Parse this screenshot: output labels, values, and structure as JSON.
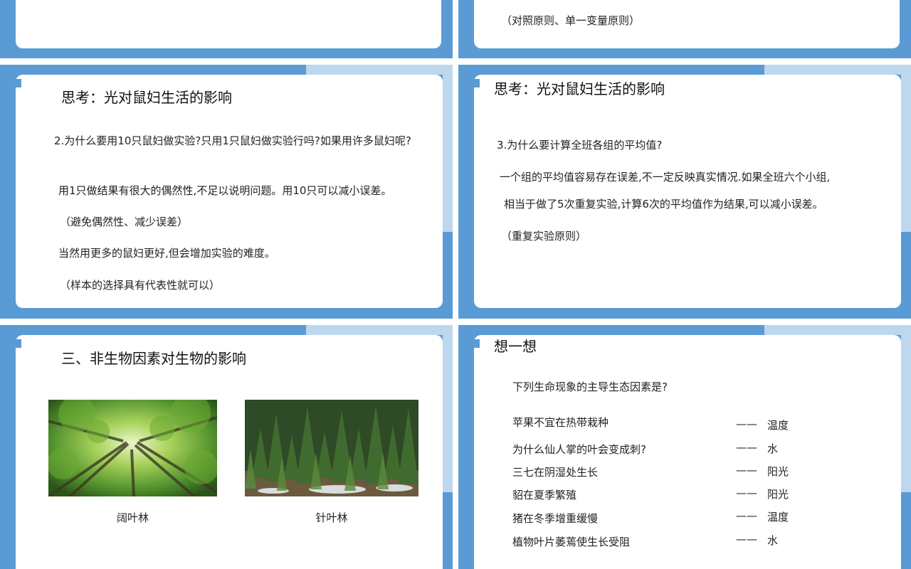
{
  "slide_top_right": {
    "text": "（对照原则、单一变量原则）"
  },
  "slide_mid_left": {
    "title": "思考：光对鼠妇生活的影响",
    "question": "2.为什么要用10只鼠妇做实验?只用1只鼠妇做实验行吗?如果用许多鼠妇呢?",
    "lines": [
      "用1只做结果有很大的偶然性,不足以说明问题。用10只可以减小误差。",
      "（避免偶然性、减少误差）",
      "当然用更多的鼠妇更好,但会增加实验的难度。",
      "（样本的选择具有代表性就可以）"
    ]
  },
  "slide_mid_right": {
    "title": "思考：光对鼠妇生活的影响",
    "question": "3.为什么要计算全班各组的平均值?",
    "lines": [
      "一个组的平均值容易存在误差,不一定反映真实情况.如果全班六个小组,",
      "相当于做了5次重复实验,计算6次的平均值作为结果,可以减小误差。",
      "（重复实验原则）"
    ]
  },
  "slide_bottom_left": {
    "title": "三、非生物因素对生物的影响",
    "images": [
      {
        "caption": "阔叶林",
        "icon": "broadleaf-forest-photo"
      },
      {
        "caption": "针叶林",
        "icon": "conifer-forest-photo"
      }
    ]
  },
  "slide_bottom_right": {
    "title": "想一想",
    "question": "下列生命现象的主导生态因素是?",
    "items": [
      {
        "phenomenon": "苹果不宜在热带栽种",
        "dash": "——",
        "factor": "温度"
      },
      {
        "phenomenon": "为什么仙人掌的叶会变成刺?",
        "dash": "——",
        "factor": "水"
      },
      {
        "phenomenon": "三七在阴湿处生长",
        "dash": "——",
        "factor": "阳光"
      },
      {
        "phenomenon": "貂在夏季繁殖",
        "dash": "——",
        "factor": "阳光"
      },
      {
        "phenomenon": "猪在冬季增重缓慢",
        "dash": "——",
        "factor": "温度"
      },
      {
        "phenomenon": "植物叶片萎蔫使生长受阻",
        "dash": "——",
        "factor": "水"
      }
    ]
  },
  "colors": {
    "accent": "#5b9bd5",
    "light_accent": "#bdd7ee",
    "card": "#ffffff"
  }
}
